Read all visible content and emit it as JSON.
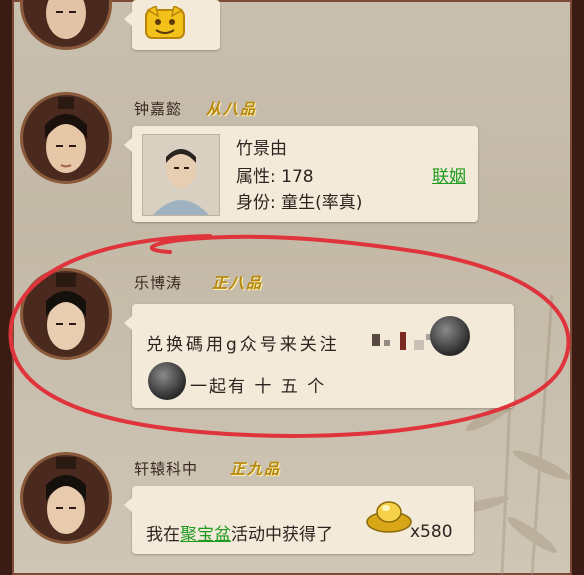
{
  "messages": [
    {
      "emoji": "smiling-face-sticker"
    },
    {
      "name": "钟嘉懿",
      "rank": "从八品",
      "card": {
        "name": "竹景由",
        "attr_label": "属性: 178",
        "identity_label": "身份: 童生(率真)",
        "action": "联姻"
      }
    },
    {
      "name": "乐博涛",
      "rank": "正八品",
      "text_line1": "兑换碼用g众号来关注",
      "text_line2": "一起有 十 五 个"
    },
    {
      "name": "轩辕科中",
      "rank": "正九品",
      "text_prefix": "我在",
      "link": "聚宝盆",
      "text_suffix": "活动中获得了",
      "count": "x580"
    }
  ],
  "colors": {
    "annotation_circle": "#e0343c",
    "link_green": "#1e9a1e",
    "rank_gold": "#b8860b"
  }
}
